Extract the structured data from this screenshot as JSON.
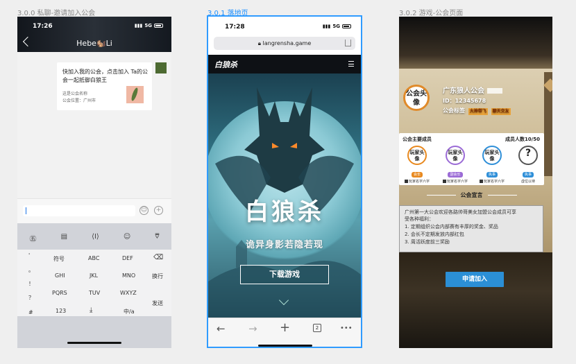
{
  "captions": [
    "3.0.0 私聊-邀请加入公会",
    "3.0.1 落地页",
    "3.0.2 游戏-公会页面"
  ],
  "chat": {
    "time": "17:26",
    "network": "5G",
    "title": "Hebe🐿️Li",
    "card_text": "快加入我的公会，点击加入 Ta的公会一起抵御白狼王",
    "card_name": "这是公会名称",
    "card_place": "公会位置：广州市"
  },
  "keyboard": {
    "toolbar": [
      "㊄",
      "▤",
      "⟨I⟩",
      "☺",
      "⩢"
    ],
    "side": [
      "'",
      "。",
      "！",
      "？",
      "#"
    ],
    "row1": [
      "符号",
      "ABC",
      "DEF",
      "⌫"
    ],
    "row2": [
      "GHI",
      "JKL",
      "MNO",
      "换行"
    ],
    "row3": [
      "PQRS",
      "TUV",
      "WXYZ",
      "发送"
    ],
    "row4": [
      "123",
      "⤓",
      "中/a"
    ]
  },
  "landing": {
    "time": "17:28",
    "network": "5G",
    "url": "langrensha.game",
    "logo": "白狼杀",
    "title": "白狼杀",
    "slogan": "诡异身影若隐若现",
    "download": "下载游戏",
    "tab_count": "2",
    "nav_icons": [
      "←",
      "→",
      "+",
      "•••"
    ]
  },
  "guild": {
    "avatar": "公会头像",
    "name": "广东狼人公会",
    "id": "ID：12345678",
    "tags_label": "公会标签",
    "tags": [
      "大神带飞",
      "聊天交友"
    ],
    "members_title": "公会主要成员",
    "members_count": "成员人数10/50",
    "members": [
      {
        "avatar": "玩家头像",
        "badge": "会长",
        "badge_color": "#e8891f",
        "name": "玩家名字六字"
      },
      {
        "avatar": "玩家头像",
        "badge": "副会长",
        "badge_color": "#9b6bd6",
        "name": "玩家名字六字"
      },
      {
        "avatar": "玩家头像",
        "badge": "执事",
        "badge_color": "#2f8fd8",
        "name": "玩家名字六字"
      },
      {
        "avatar": "?",
        "badge": "执事",
        "badge_color": "#2f8fd8",
        "name": "虚位以待"
      }
    ],
    "declaration_title": "公会宣言",
    "declaration": [
      "广州第一大公会欢迎各路帅哥美女加盟公会成员可享",
      "受各种福利：",
      "1. 定期组织公会内部赛有丰厚的奖金、奖品",
      "2. 会长不定期发放内部红包",
      "3. 周活跃度前三奖励"
    ],
    "apply": "申请加入"
  }
}
